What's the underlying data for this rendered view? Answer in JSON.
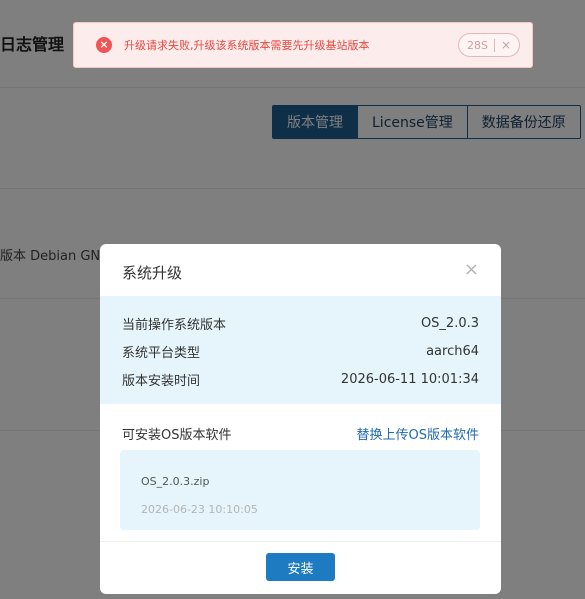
{
  "page": {
    "header_title": "日志管理",
    "tabs": [
      "版本管理",
      "License管理",
      "数据备份还原"
    ],
    "os_info_partial": "版本 Debian GNU"
  },
  "alert": {
    "message": "升级请求失败,升级该系统版本需要先升级基站版本",
    "countdown": "28S",
    "close": "×"
  },
  "modal": {
    "title": "系统升级",
    "close": "×",
    "info": [
      {
        "label": "当前操作系统版本",
        "value": "OS_2.0.3"
      },
      {
        "label": "系统平台类型",
        "value": "aarch64"
      },
      {
        "label": "版本安装时间",
        "value": "2026-06-11 10:01:34"
      }
    ],
    "package_label": "可安装OS版本软件",
    "replace_link": "替换上传OS版本软件",
    "package": {
      "name": "OS_2.0.3.zip",
      "date": "2026-06-23 10:10:05"
    },
    "install_button": "安装"
  }
}
